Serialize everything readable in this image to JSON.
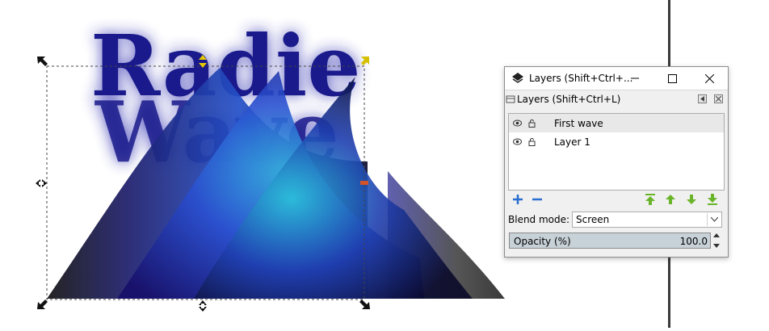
{
  "canvas": {
    "drawing": {
      "title_text_back": "Radie",
      "title_text_front": "Wave",
      "title_color": "#1a1a8c"
    }
  },
  "layers_dialog": {
    "window_title": "Layers (Shift+Ctrl+...",
    "panel_title": "Layers (Shift+Ctrl+L)",
    "layers": [
      {
        "name": "First wave",
        "selected": true,
        "visible": true,
        "locked": false
      },
      {
        "name": "Layer 1",
        "selected": false,
        "visible": true,
        "locked": false
      }
    ],
    "blend_mode_label": "Blend mode:",
    "blend_mode_value": "Screen",
    "opacity_label": "Opacity (%)",
    "opacity_value": "100.0",
    "opacity_fraction": 1.0,
    "icons": [
      "layers-icon",
      "minimize-icon",
      "maximize-icon",
      "close-icon",
      "add-layer-icon",
      "remove-layer-icon",
      "raise-to-top-icon",
      "raise-icon",
      "lower-icon",
      "lower-to-bottom-icon",
      "eye-icon",
      "unlock-icon"
    ]
  },
  "colors": {
    "accent_green": "#6ab42a",
    "accent_blue": "#2a6ecf",
    "selection_handle": "#e6c800"
  }
}
